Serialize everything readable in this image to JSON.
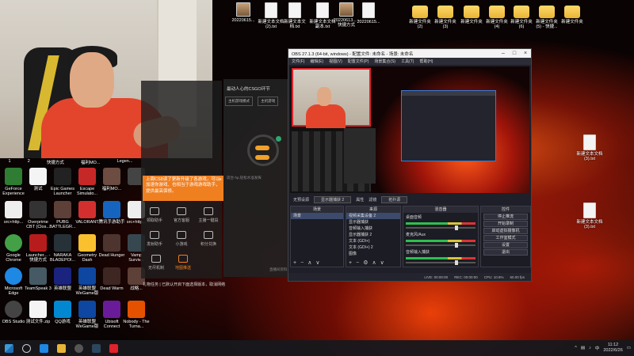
{
  "desktop_top_icons": [
    {
      "label": "20220615..."
    },
    {
      "label": "新建文本文档 (2).txt"
    },
    {
      "label": "新建文本文档.txt"
    },
    {
      "label": "新建文本文档 副本.txt"
    },
    {
      "label": "20220613... - 快捷方式"
    },
    {
      "label": "20220615..."
    },
    {
      "label": "新建文件夹 (2)"
    },
    {
      "label": "新建文件夹 (3)"
    },
    {
      "label": "新建文件夹"
    },
    {
      "label": "新建文件夹 (4)"
    },
    {
      "label": "新建文件夹 (6)"
    },
    {
      "label": "新建文件夹 (5) - 快捷..."
    },
    {
      "label": "新建文件夹"
    }
  ],
  "desktop_right_icons": [
    {
      "label": "新建文本文档 (3).txt"
    },
    {
      "label": "新建文本文档 (3).txt"
    }
  ],
  "desktop_left_icons": [
    {
      "label": "GeForce Experience"
    },
    {
      "label": "测试"
    },
    {
      "label": "Epic Games Launcher"
    },
    {
      "label": "Escape Simulato..."
    },
    {
      "label": "福利MO..."
    },
    {
      "label": ""
    },
    {
      "label": "src+http..."
    },
    {
      "label": "Overprime CBT (Clos..."
    },
    {
      "label": "PUBG BATTLEGR..."
    },
    {
      "label": "VALORANT"
    },
    {
      "label": "腾讯手游助手"
    },
    {
      "label": "src+http..."
    },
    {
      "label": "Google Chrome"
    },
    {
      "label": "Launcher... - 快捷方式"
    },
    {
      "label": "NARAKA BLADEPOI..."
    },
    {
      "label": "Geometry Dash"
    },
    {
      "label": "Dead Hunger"
    },
    {
      "label": "Vamp Surviv..."
    },
    {
      "label": "Microsoft Edge"
    },
    {
      "label": "TeamSpeak 3"
    },
    {
      "label": "英雄联盟"
    },
    {
      "label": "英雄联盟 WeGame版"
    },
    {
      "label": "Dead Warm"
    },
    {
      "label": "战略..."
    },
    {
      "label": "OBS Studio"
    },
    {
      "label": "测试文件.zip"
    },
    {
      "label": "QQ游戏"
    },
    {
      "label": "英雄联盟 WeGame版"
    },
    {
      "label": "Ubisoft Connect"
    },
    {
      "label": "Nobody - The Turna..."
    }
  ],
  "webcam_row_labels": [
    "1",
    "2",
    "快捷方式",
    "福利MO...",
    "Legen..."
  ],
  "helper": {
    "title": "最动人心的CSGO环节",
    "mini_buttons": [
      "主机游戏模式",
      "主机游戏"
    ],
    "note": "适合-hp,轻松水准发挥"
  },
  "notice": {
    "text": "上周CS8读了更新升级了各游戏，可以加速你游戏、也相当于游戏游戏助手，提供最高保修。",
    "close": "×"
  },
  "overlay_rows": [
    [
      {
        "label": "领取助手"
      },
      {
        "label": "官方客服"
      },
      {
        "label": "主播一键段"
      }
    ],
    [
      {
        "label": "发射助手"
      },
      {
        "label": "小游戏"
      },
      {
        "label": "积分兑换"
      }
    ],
    [
      {
        "label": "无尽机制"
      },
      {
        "label": "地图推送",
        "active": true
      }
    ]
  ],
  "overlay_footer": "礼物任务  |  已默认开启下面选择版本，取消网络",
  "overlay_side_label": "直播间资料",
  "obs": {
    "title": "OBS 27.1.3 (64-bit, windows) - 配置文件: 未命名 - 场景: 未命名",
    "menu": [
      "文件(F)",
      "编辑(E)",
      "视图(V)",
      "配置文件(P)",
      "场景集合(S)",
      "工具(T)",
      "帮助(H)"
    ],
    "window_buttons": {
      "min": "–",
      "max": "□",
      "close": "×"
    },
    "scene_bar": {
      "label": "无预设源",
      "selected": "显示器捕获 2",
      "filter": "滤镜",
      "properties": "属性",
      "extra": "拓扑源"
    },
    "docks": {
      "scenes": {
        "header": "场景",
        "items": [
          "场景"
        ]
      },
      "sources": {
        "header": "来源",
        "items": [
          "视频采集设备 2",
          "显示器捕获",
          "音频输入捕获",
          "显示器捕获 2",
          "文本 (GDI+)",
          "文本 (GDI+) 2",
          "图像"
        ]
      },
      "mixer": {
        "header": "混音器",
        "items": [
          "桌面音频",
          "麦克风/Aux",
          "音频输入捕获"
        ]
      },
      "controls": {
        "header": "控件",
        "items": [
          "停止推流",
          "开始录制",
          "启动虚拟摄像机",
          "工作室模式",
          "设置",
          "退出"
        ]
      },
      "footer": {
        "add": "+",
        "remove": "−",
        "up": "∧",
        "down": "∨",
        "gear": "⚙"
      }
    },
    "status": {
      "live": "LIVE: 00:00:00",
      "rec": "REC: 00:00:00",
      "cpu": "CPU: 10.8%",
      "fps": "60.00 fps"
    }
  },
  "taskbar": {
    "time": "11:12",
    "date": "2022/6/26",
    "lang": "中"
  },
  "colors": {
    "accent_orange": "#f07f20",
    "obs_selection": "#3c4a6b",
    "preview_border": "#e0222a"
  }
}
